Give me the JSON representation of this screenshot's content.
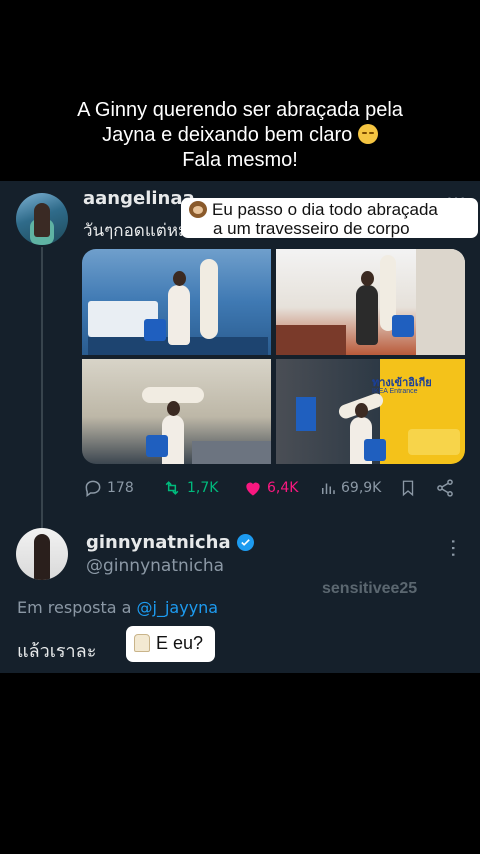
{
  "overlay": {
    "caption_line1": "A Ginny querendo ser abraçada pela",
    "caption_line2": "Jayna e deixando bem claro",
    "caption_line3": "Fala mesmo!",
    "caption_emoji": "relieved-face"
  },
  "tweet1": {
    "username": "aangelinaa",
    "text": "วันๆกอดแต่หมอน",
    "sticker_line1": "Eu passo o dia todo abraçada",
    "sticker_line2": "a um travesseiro de corpo",
    "sticker_emoji": "monkey",
    "replies": "178",
    "retweets": "1,7K",
    "likes": "6,4K",
    "views": "69,9K",
    "photo4_sign": "ทางเข้าอิเกีย",
    "photo4_sign_sub": "IKEA Entrance",
    "colors": {
      "retweet": "#00ba7c",
      "like": "#f91880"
    }
  },
  "tweet2": {
    "username": "ginnynatnicha",
    "handle": "@ginnynatnicha",
    "reply_prefix": "Em resposta a",
    "reply_mention": "@j_jayyna",
    "text": "แล้วเราละ",
    "sticker_text": "E eu?",
    "sticker_emoji": "llama",
    "watermark": "sensitivee25"
  },
  "theme": {
    "background": "#15202b",
    "accent": "#1d9bf0",
    "muted": "#8b98a5"
  }
}
